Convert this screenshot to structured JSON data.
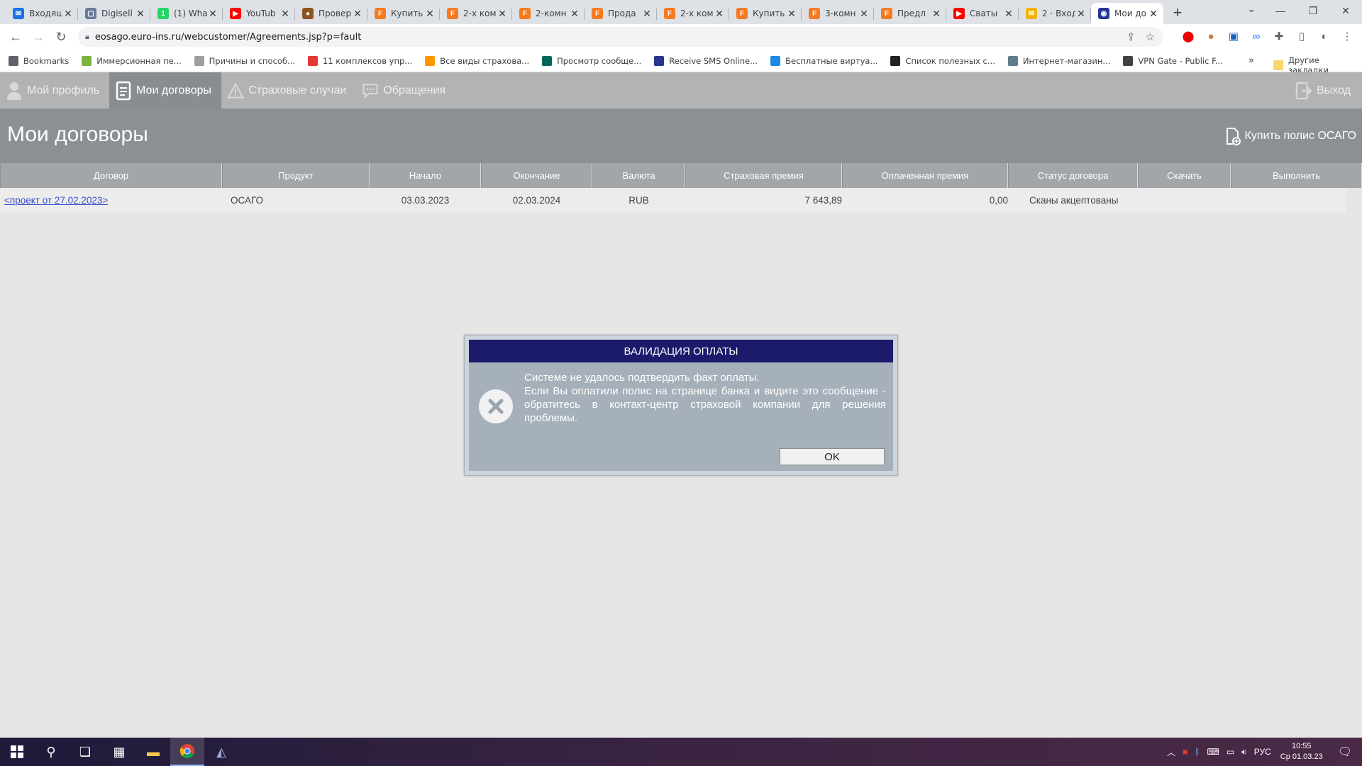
{
  "browser": {
    "tabs": [
      {
        "title": "Входящ",
        "color": "#1a73e8",
        "glyph": "✉"
      },
      {
        "title": "Digisell",
        "color": "#6b7a99",
        "glyph": "▢"
      },
      {
        "title": "(1) Wha",
        "color": "#25d366",
        "glyph": "1"
      },
      {
        "title": "YouTub",
        "color": "#ff0000",
        "glyph": "▶"
      },
      {
        "title": "Провер",
        "color": "#8d5524",
        "glyph": "●"
      },
      {
        "title": "Купить",
        "color": "#f47b20",
        "glyph": "F"
      },
      {
        "title": "2-х ком",
        "color": "#f47b20",
        "glyph": "F"
      },
      {
        "title": "2-комн",
        "color": "#f47b20",
        "glyph": "F"
      },
      {
        "title": "Прода",
        "color": "#f47b20",
        "glyph": "F"
      },
      {
        "title": "2-х ком",
        "color": "#f47b20",
        "glyph": "F"
      },
      {
        "title": "Купить",
        "color": "#f47b20",
        "glyph": "F"
      },
      {
        "title": "3-комн",
        "color": "#f47b20",
        "glyph": "F"
      },
      {
        "title": "Предл",
        "color": "#f47b20",
        "glyph": "F"
      },
      {
        "title": "Сваты",
        "color": "#ff0000",
        "glyph": "▶"
      },
      {
        "title": "2 · Вход",
        "color": "#f4b400",
        "glyph": "✉"
      },
      {
        "title": "Мои до",
        "color": "#283593",
        "glyph": "◉"
      }
    ],
    "url": "eosago.euro-ins.ru/webcustomer/Agreements.jsp?p=fault",
    "bookmarks": [
      {
        "label": "Bookmarks",
        "color": "#5f6368"
      },
      {
        "label": "Иммерсионная пе...",
        "color": "#7cb342"
      },
      {
        "label": "Причины и способ...",
        "color": "#9e9e9e"
      },
      {
        "label": "11 комплексов упр...",
        "color": "#e53935"
      },
      {
        "label": "Все виды страхова...",
        "color": "#ff9800"
      },
      {
        "label": "Просмотр сообще...",
        "color": "#00695c"
      },
      {
        "label": "Receive SMS Online...",
        "color": "#283593"
      },
      {
        "label": "Бесплатные виртуа...",
        "color": "#1e88e5"
      },
      {
        "label": "Список полезных с...",
        "color": "#212121"
      },
      {
        "label": "Интернет-магазин...",
        "color": "#607d8b"
      },
      {
        "label": "VPN Gate - Public F...",
        "color": "#424242"
      }
    ],
    "bookmarks_more": "»",
    "other_bookmarks": "Другие закладки"
  },
  "site_nav": {
    "items": [
      {
        "label": "Мой профиль",
        "active": false
      },
      {
        "label": "Мои договоры",
        "active": true
      },
      {
        "label": "Страховые случаи",
        "active": false
      },
      {
        "label": "Обращения",
        "active": false
      }
    ],
    "exit": "Выход"
  },
  "page": {
    "title": "Мои договоры",
    "buy_button": "Купить полис ОСАГО"
  },
  "table": {
    "columns": [
      "Договор",
      "Продукт",
      "Начало",
      "Окончание",
      "Валюта",
      "Страховая премия",
      "Оплаченная премия",
      "Статус договора",
      "Скачать",
      "Выполнить"
    ],
    "rows": [
      {
        "contract": "<проект от 27.02.2023>",
        "product": "ОСАГО",
        "start": "03.03.2023",
        "end": "02.03.2024",
        "currency": "RUB",
        "premium": "7 643,89",
        "paid": "0,00",
        "status": "Сканы акцептованы",
        "download": "",
        "action": ""
      }
    ]
  },
  "modal": {
    "title": "ВАЛИДАЦИЯ ОПЛАТЫ",
    "line1": "Системе не удалось подтвердить факт оплаты.",
    "line2": "Если Вы оплатили полис на странице банка и видите это сообщение - обратитесь в контакт-центр страховой компании для решения проблемы.",
    "ok": "OK"
  },
  "taskbar": {
    "lang": "РУС",
    "time": "10:55",
    "date": "Ср 01.03.23"
  }
}
